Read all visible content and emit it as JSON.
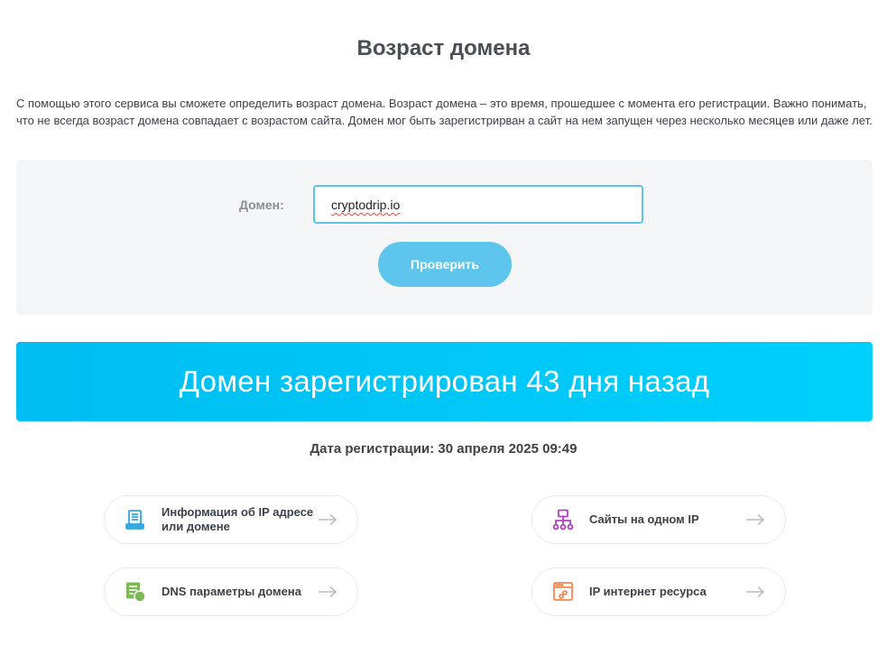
{
  "title": "Возраст домена",
  "intro": "С помощью этого сервиса вы сможете определить возраст домена. Возраст домена – это время, прошедшее с момента его регистрации. Важно понимать, что не всегда возраст домена совпадает с возрастом сайта. Домен мог быть зарегистрирван а сайт на нем запущен через несколько месяцев или даже лет.",
  "form": {
    "domain_label": "Домен:",
    "domain_value": "cryptodrip.io",
    "check_label": "Проверить"
  },
  "result": {
    "banner_text": "Домен зарегистрирован 43 дня назад",
    "registration_date": "Дата регистрации: 30 апреля 2025 09:49"
  },
  "links": [
    {
      "label": "Информация об IP адресе или домене",
      "icon": "server-info-icon",
      "color": "#35a8e0"
    },
    {
      "label": "Сайты на одном IP",
      "icon": "sitemap-icon",
      "color": "#b13fc4"
    },
    {
      "label": "DNS параметры домена",
      "icon": "dns-server-icon",
      "color": "#7cb956"
    },
    {
      "label": "IP интернет ресурса",
      "icon": "browser-link-icon",
      "color": "#f0884f"
    }
  ],
  "colors": {
    "accent": "#5ec6ec",
    "banner": "#00c4f6",
    "arrow": "#b8bcc2"
  }
}
